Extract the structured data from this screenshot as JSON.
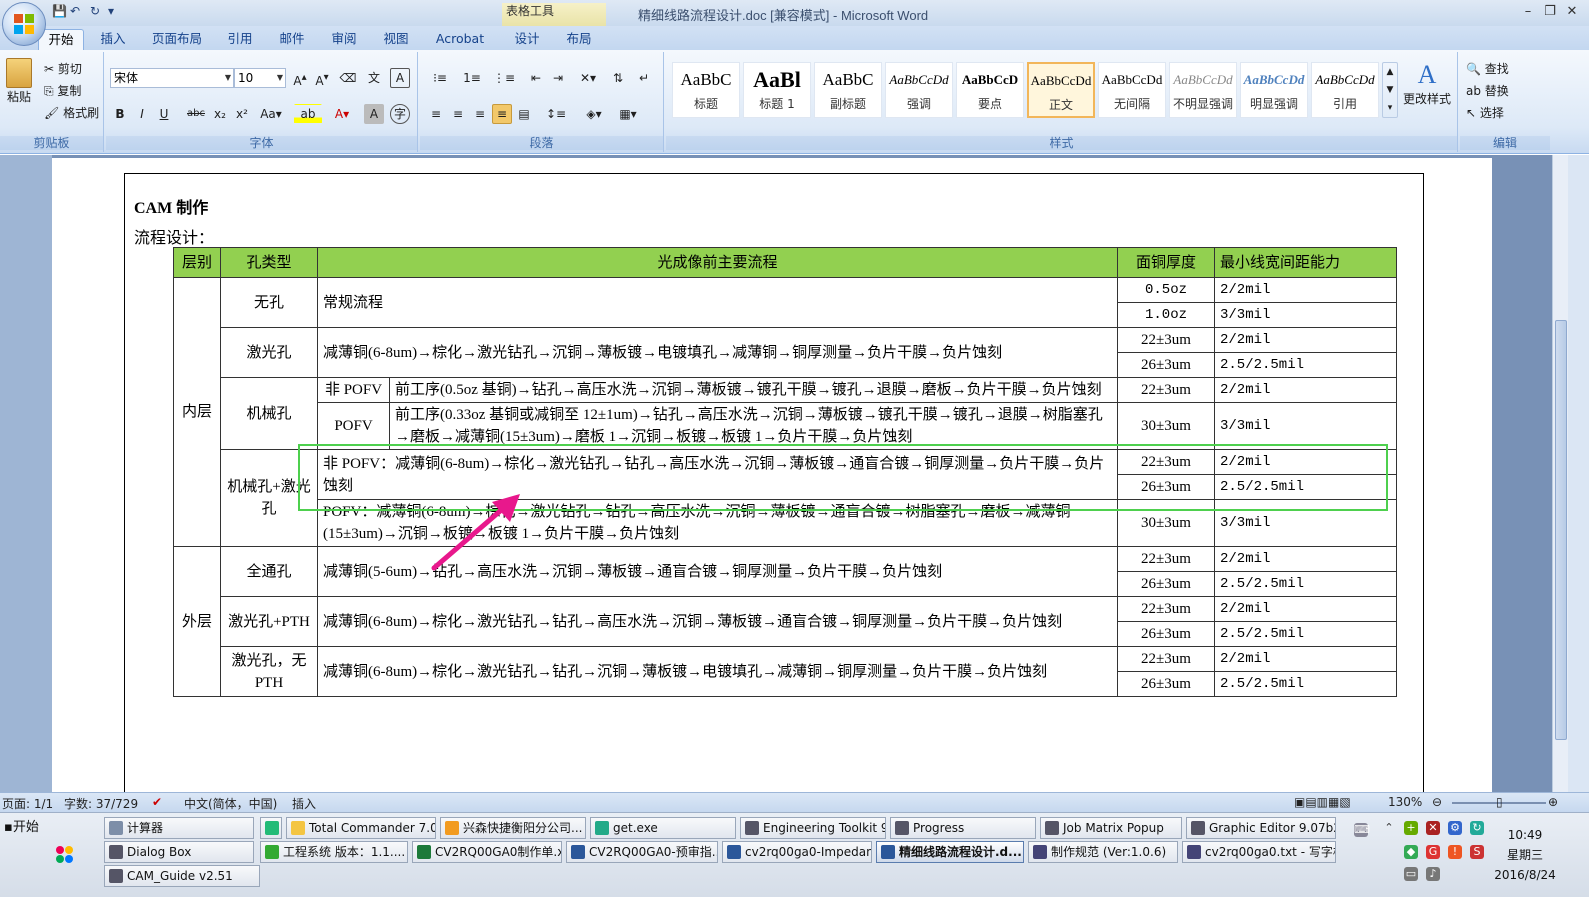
{
  "window": {
    "title": "精细线路流程设计.doc [兼容模式] - Microsoft Word",
    "context_tab": "表格工具"
  },
  "ribbon_tabs": [
    "开始",
    "插入",
    "页面布局",
    "引用",
    "邮件",
    "审阅",
    "视图",
    "Acrobat",
    "设计",
    "布局"
  ],
  "clipboard": {
    "paste": "粘贴",
    "cut": "剪切",
    "copy": "复制",
    "format_painter": "格式刷",
    "label": "剪贴板"
  },
  "font": {
    "name": "宋体",
    "size": "10",
    "label": "字体"
  },
  "paragraph": {
    "label": "段落"
  },
  "styles": {
    "label": "样式",
    "change_styles": "更改样式",
    "items": [
      {
        "sample": "AaBbC",
        "name": "标题"
      },
      {
        "sample": "AaBl",
        "name": "标题 1"
      },
      {
        "sample": "AaBbC",
        "name": "副标题"
      },
      {
        "sample": "AaBbCcDd",
        "name": "强调"
      },
      {
        "sample": "AaBbCcD",
        "name": "要点"
      },
      {
        "sample": "AaBbCcDd",
        "name": "正文"
      },
      {
        "sample": "AaBbCcDd",
        "name": "无间隔"
      },
      {
        "sample": "AaBbCcDd",
        "name": "不明显强调"
      },
      {
        "sample": "AaBbCcDd",
        "name": "明显强调"
      },
      {
        "sample": "AaBbCcDd",
        "name": "引用"
      }
    ]
  },
  "editing": {
    "find": "查找",
    "replace": "替换",
    "select": "选择",
    "label": "编辑"
  },
  "document": {
    "heading": "CAM 制作",
    "subheading": "流程设计：",
    "table": {
      "headers": [
        "层别",
        "孔类型",
        "光成像前主要流程",
        "面铜厚度",
        "最小线宽间距能力"
      ],
      "layer_inner": "内层",
      "layer_outer": "外层",
      "types": {
        "no_hole": "无孔",
        "laser": "激光孔",
        "mech": "机械孔",
        "mech_laser": "机械孔+激光孔",
        "through": "全通孔",
        "laser_pth": "激光孔+PTH",
        "laser_no_pth": "激光孔，无PTH"
      },
      "sub": {
        "non_pofv": "非 POFV",
        "pofv": "POFV"
      },
      "flows": {
        "regular": "常规流程",
        "laser": "减薄铜(6-8um)→棕化→激光钻孔→沉铜→薄板镀→电镀填孔→减薄铜→铜厚测量→负片干膜→负片蚀刻",
        "mech_non_pofv": "前工序(0.5oz 基铜)→钻孔→高压水洗→沉铜→薄板镀→镀孔干膜→镀孔→退膜→磨板→负片干膜→负片蚀刻",
        "mech_pofv": "前工序(0.33oz 基铜或减铜至 12±1um)→钻孔→高压水洗→沉铜→薄板镀→镀孔干膜→镀孔→退膜→树脂塞孔→磨板→减薄铜(15±3um)→磨板 1→沉铜→板镀→板镀 1→负片干膜→负片蚀刻",
        "ml_non_pofv": "非 POFV：减薄铜(6-8um)→棕化→激光钻孔→钻孔→高压水洗→沉铜→薄板镀→通盲合镀→铜厚测量→负片干膜→负片蚀刻",
        "ml_pofv": "POFV：减薄铜(6-8um)→棕化→激光钻孔→钻孔→高压水洗→沉铜→薄板镀→通盲合镀→树脂塞孔→磨板→减薄铜(15±3um)→沉铜→板镀→板镀 1→负片干膜→负片蚀刻",
        "through": "减薄铜(5-6um)→钻孔→高压水洗→沉铜→薄板镀→通盲合镀→铜厚测量→负片干膜→负片蚀刻",
        "laser_pth": "减薄铜(6-8um)→棕化→激光钻孔→钻孔→高压水洗→沉铜→薄板镀→通盲合镀→铜厚测量→负片干膜→负片蚀刻",
        "laser_no_pth": "减薄铜(6-8um)→棕化→激光钻孔→钻孔→沉铜→薄板镀→电镀填孔→减薄铜→铜厚测量→负片干膜→负片蚀刻"
      },
      "thick": {
        "t05": "0.5oz",
        "t10": "1.0oz",
        "t22": "22±3um",
        "t26": "26±3um",
        "t30": "30±3um"
      },
      "cap": {
        "c22": "2/2mil",
        "c33": "3/3mil",
        "c25": "2.5/2.5mil"
      }
    }
  },
  "statusbar": {
    "page": "页面: 1/1",
    "words": "字数: 37/729",
    "language": "中文(简体，中国)",
    "mode": "插入",
    "zoom": "130%"
  },
  "taskbar": {
    "start": "开始",
    "row1": [
      "计算器",
      "Total Commander 7.0 ...",
      "兴森快捷衡阳分公司...",
      "get.exe",
      "Engineering Toolkit 9.0...",
      "Progress",
      "Job Matrix Popup",
      "Graphic Editor 9.07b2 ..."
    ],
    "row2": [
      "Dialog Box",
      "工程系统  版本：1.1....",
      "CV2RQ00GA0制作单.xl...",
      "CV2RQ00GA0-预审指...",
      "cv2rq00ga0-Impedance...",
      "精细线路流程设计.d...",
      "制作规范 (Ver:1.0.6)",
      "cv2rq00ga0.txt - 写字板"
    ],
    "row3": [
      "CAM_Guide v2.51"
    ],
    "time": "10:49",
    "weekday": "星期三",
    "date": "2016/8/24"
  },
  "colors": {
    "header_green": "#92d050",
    "highlight_box": "#4ed04e",
    "arrow": "#e8188c"
  }
}
